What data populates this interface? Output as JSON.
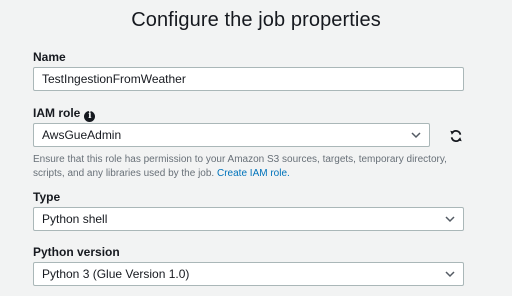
{
  "page": {
    "title": "Configure the job properties"
  },
  "name_field": {
    "label": "Name",
    "value": "TestIngestionFromWeather"
  },
  "iam_role": {
    "label": "IAM role",
    "info_icon": "info-icon",
    "value": "AwsGueAdmin",
    "refresh_icon": "refresh-icon",
    "help_text": "Ensure that this role has permission to your Amazon S3 sources, targets, temporary directory, scripts, and any libraries used by the job.",
    "help_link": "Create IAM role."
  },
  "type_field": {
    "label": "Type",
    "value": "Python shell"
  },
  "python_version": {
    "label": "Python version",
    "value": "Python 3 (Glue Version 1.0)"
  },
  "colors": {
    "accent": "#0073bb",
    "border": "#aab7b8",
    "background": "#f2f3f3"
  }
}
